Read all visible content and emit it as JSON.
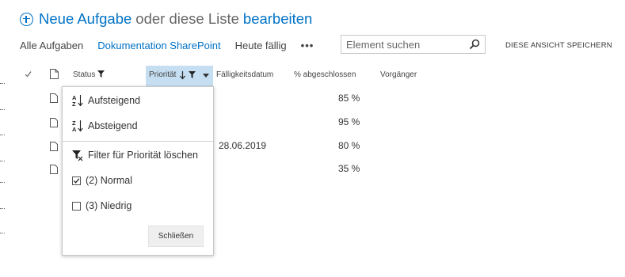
{
  "header": {
    "new_task": "Neue Aufgabe",
    "or_text": "oder diese Liste",
    "edit": "bearbeiten"
  },
  "views": {
    "items": [
      "Alle Aufgaben",
      "Dokumentation SharePoint",
      "Heute fällig"
    ],
    "more": "•••",
    "search_placeholder": "Element suchen",
    "save_view": "DIESE ANSICHT SPEICHERN"
  },
  "columns": {
    "status": "Status",
    "priority": "Priorität",
    "due_date": "Fälligkeitsdatum",
    "percent": "% abgeschlossen",
    "predecessor": "Vorgänger"
  },
  "rows": [
    {
      "due_date": "",
      "percent": "85 %"
    },
    {
      "due_date": "",
      "percent": "95 %"
    },
    {
      "due_date": "28.06.2019",
      "percent": "80 %"
    },
    {
      "due_date": "",
      "percent": "35 %"
    }
  ],
  "menu": {
    "ascending": "Aufsteigend",
    "descending": "Absteigend",
    "clear_filter": "Filter für Priorität löschen",
    "options": [
      {
        "label": "(2) Normal",
        "checked": true
      },
      {
        "label": "(3) Niedrig",
        "checked": false
      }
    ],
    "close": "Schließen"
  },
  "colors": {
    "accent": "#0072c6",
    "header_highlight": "#c6def1"
  },
  "icons": [
    "add-circle-icon",
    "search-icon",
    "checkmark-icon",
    "document-icon",
    "filter-icon",
    "sort-down-arrow-icon",
    "chevron-down-icon",
    "sort-ascending-icon",
    "sort-descending-icon",
    "clear-filter-icon"
  ]
}
